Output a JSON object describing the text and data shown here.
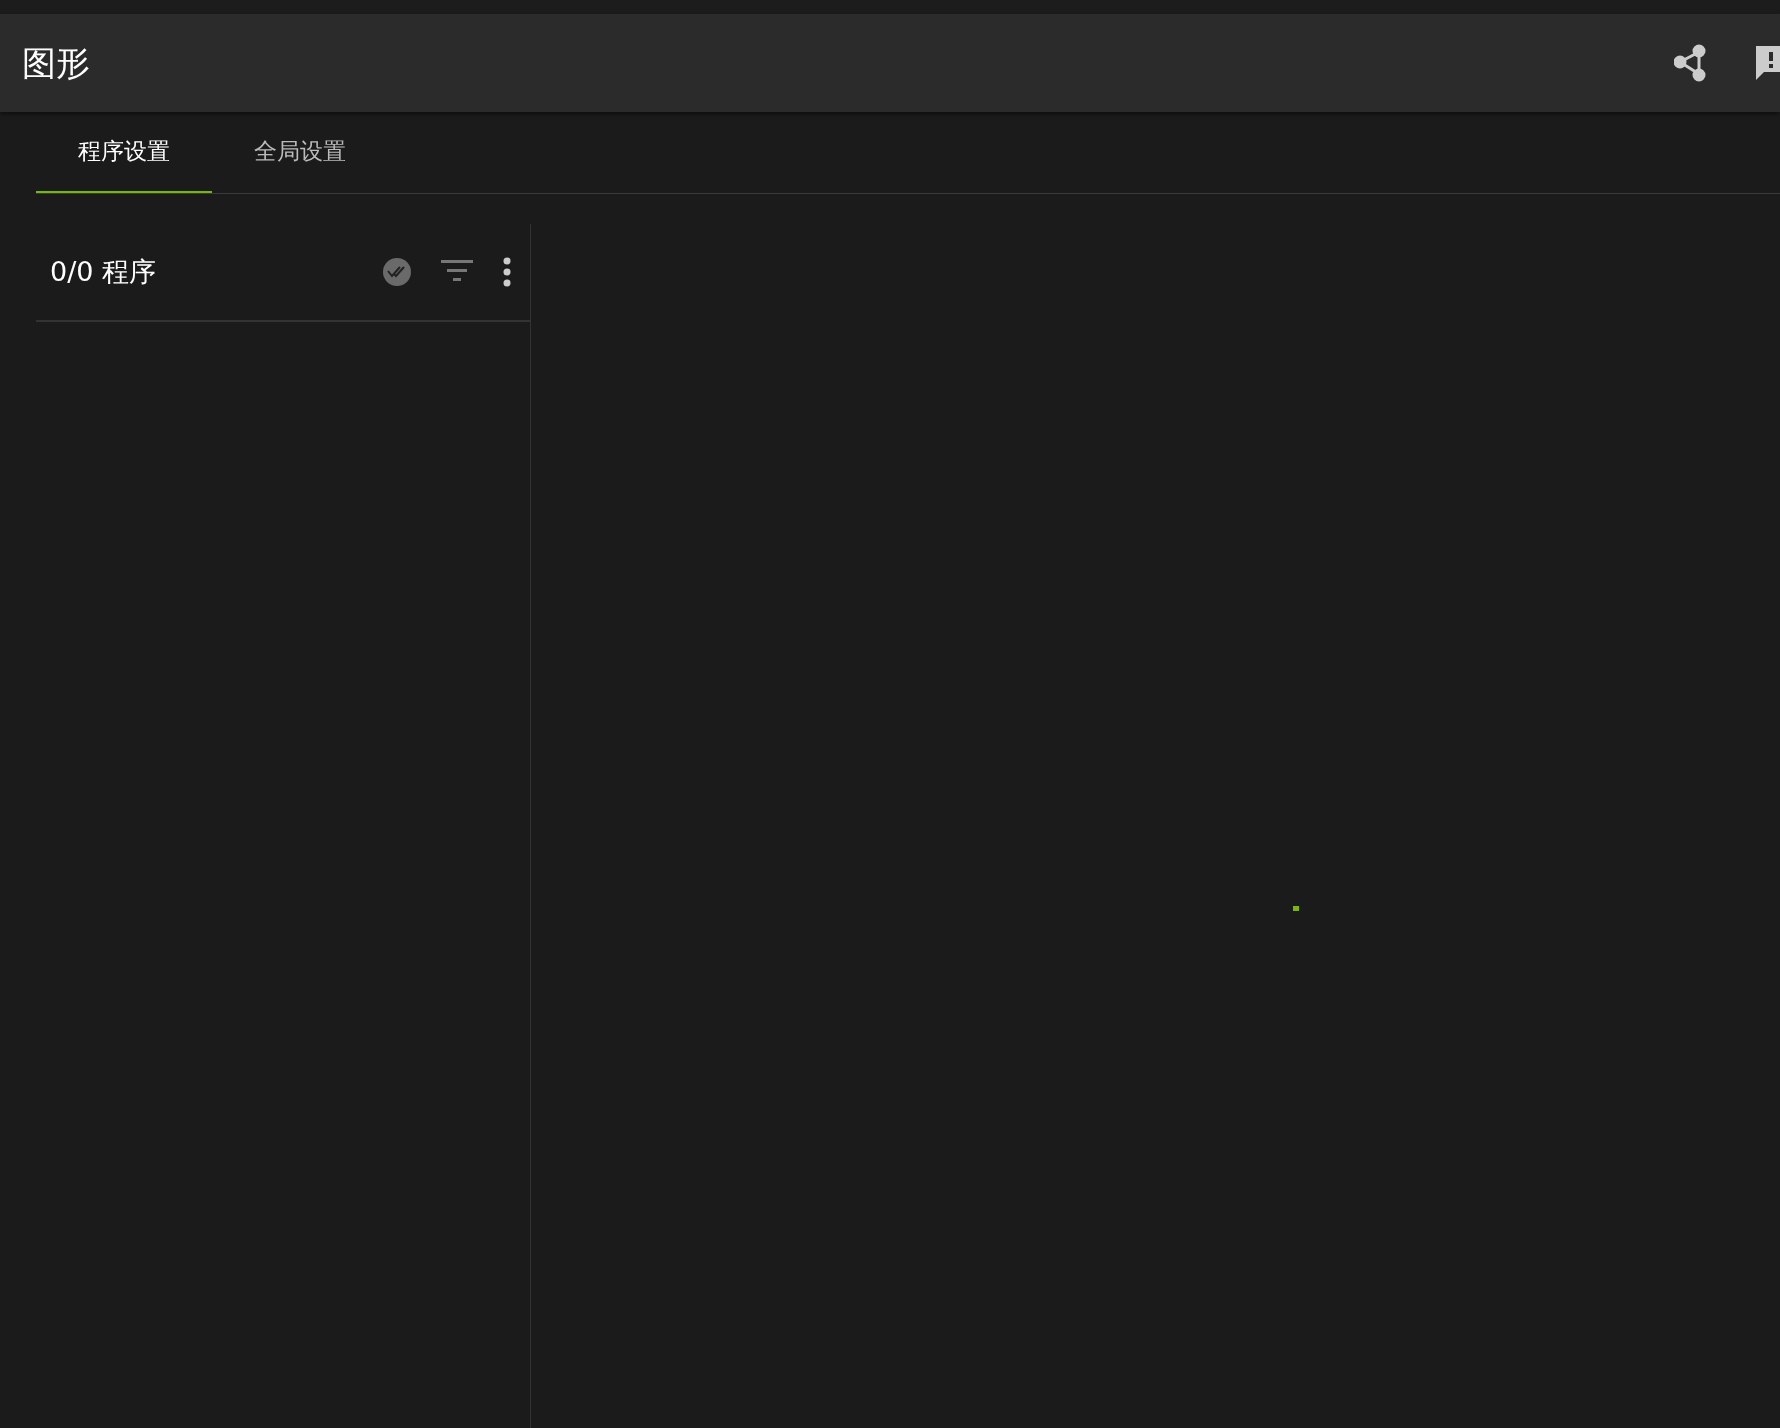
{
  "header": {
    "title": "图形"
  },
  "tabs": [
    {
      "label": "程序设置",
      "selected": true
    },
    {
      "label": "全局设置",
      "selected": false
    }
  ],
  "program_panel": {
    "title": "0/0 程序"
  }
}
